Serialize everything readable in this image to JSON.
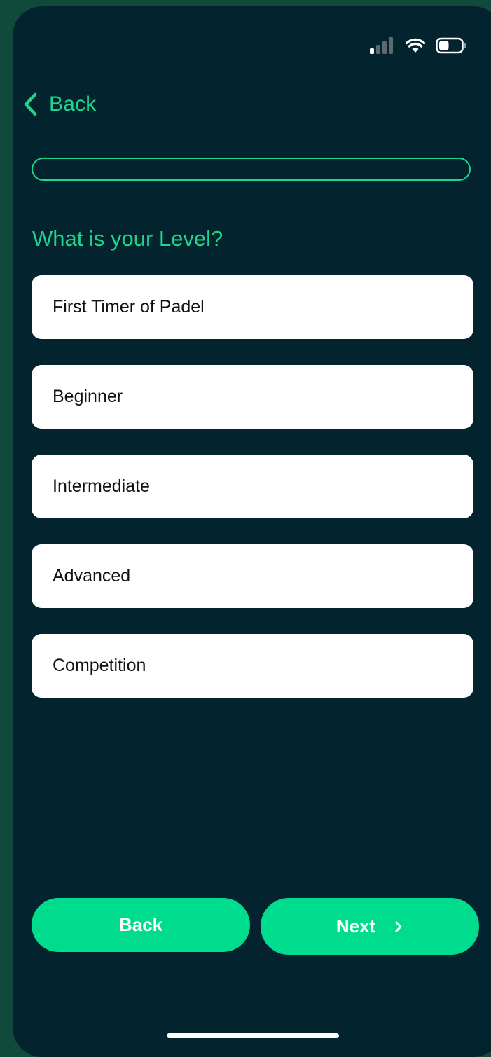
{
  "status_bar": {
    "signal_icon": "signal-bars-icon",
    "wifi_icon": "wifi-icon",
    "battery_icon": "battery-icon",
    "battery_level": 0.45
  },
  "nav": {
    "back_label": "Back",
    "back_icon": "chevron-left-icon"
  },
  "progress": {
    "fraction": 0
  },
  "question": "What is your Level?",
  "options": [
    "First Timer of Padel",
    "Beginner",
    "Intermediate",
    "Advanced",
    "Competition"
  ],
  "footer": {
    "back_label": "Back",
    "next_label": "Next",
    "next_icon": "chevron-right-icon"
  },
  "colors": {
    "background": "#03242e",
    "accent": "#1ed58d",
    "button": "#00dc8d",
    "option_bg": "#ffffff"
  }
}
